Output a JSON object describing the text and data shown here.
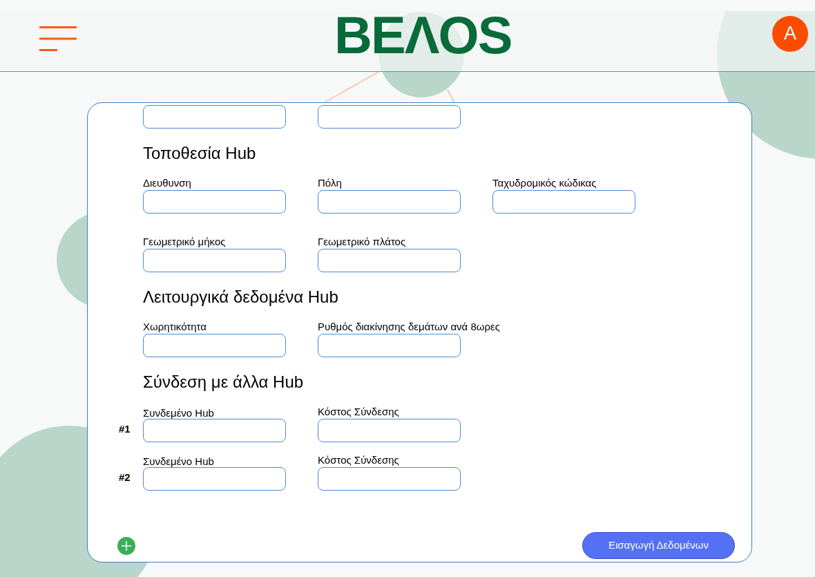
{
  "header": {
    "logo": "BEΛOS",
    "avatar": "A"
  },
  "form": {
    "top_fields": [
      {
        "kind": "text"
      },
      {
        "kind": "text"
      }
    ],
    "sections": [
      {
        "title": "Τοποθεσία Hub",
        "rows": [
          {
            "fields": [
              {
                "label": "Διευθυνση"
              },
              {
                "label": "Πόλη"
              },
              {
                "label": "Ταχυδρομικός κώδικας"
              }
            ]
          },
          {
            "fields": [
              {
                "label": "Γεωμετρικό μήκος"
              },
              {
                "label": "Γεωμετρικό πλάτος"
              }
            ]
          }
        ]
      },
      {
        "title": "Λειτουργικά δεδομένα Hub",
        "rows": [
          {
            "fields": [
              {
                "label": "Χωρητικότητα"
              },
              {
                "label": "Ρυθμός διακίνησης δεμάτων ανά 8ωρες"
              }
            ]
          }
        ]
      },
      {
        "title": "Σύνδεση με άλλα Hub",
        "rows": [
          {
            "index": "#1",
            "fields": [
              {
                "label": "Συνδεμένο Hub"
              },
              {
                "label": "Κόστος Σύνδεσης"
              }
            ]
          },
          {
            "index": "#2",
            "fields": [
              {
                "label": "Συνδεμένο Hub"
              },
              {
                "label": "Κόστος Σύνδεσης"
              }
            ]
          }
        ]
      }
    ],
    "submit": "Εισαγωγή Δεδομένων"
  }
}
